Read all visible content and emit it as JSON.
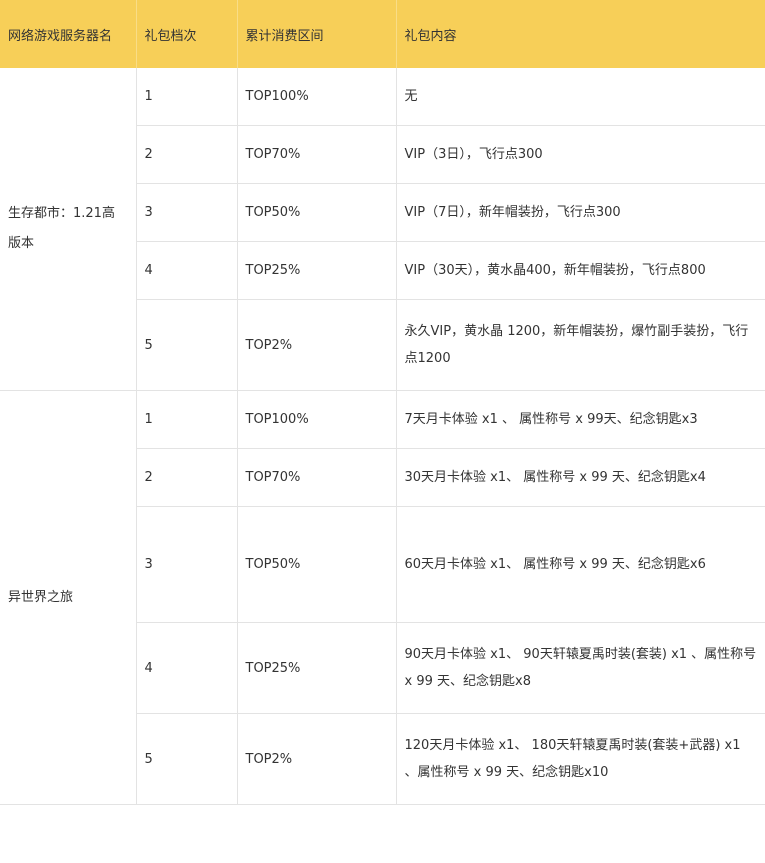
{
  "table": {
    "headers": [
      "网络游戏服务器名",
      "礼包档次",
      "累计消费区间",
      "礼包内容"
    ],
    "groups": [
      {
        "server": "生存都市：1.21高版本",
        "rows": [
          {
            "tier": "1",
            "range": "TOP100%",
            "content": "无"
          },
          {
            "tier": "2",
            "range": "TOP70%",
            "content": "VIP（3日），飞行点300"
          },
          {
            "tier": "3",
            "range": "TOP50%",
            "content": "VIP（7日），新年帽装扮，飞行点300"
          },
          {
            "tier": "4",
            "range": "TOP25%",
            "content": "VIP（30天），黄水晶400，新年帽装扮，飞行点800"
          },
          {
            "tier": "5",
            "range": "TOP2%",
            "content": "永久VIP，黄水晶 1200，新年帽装扮，爆竹副手装扮，飞行点1200"
          }
        ]
      },
      {
        "server": "异世界之旅",
        "rows": [
          {
            "tier": "1",
            "range": "TOP100%",
            "content": "7天月卡体验 x1 、 属性称号 x 99天、纪念钥匙x3"
          },
          {
            "tier": "2",
            "range": "TOP70%",
            "content": "30天月卡体验 x1、 属性称号 x 99 天、纪念钥匙x4"
          },
          {
            "tier": "3",
            "range": "TOP50%",
            "content": "60天月卡体验 x1、 属性称号 x 99 天、纪念钥匙x6"
          },
          {
            "tier": "4",
            "range": "TOP25%",
            "content": "90天月卡体验 x1、 90天轩辕夏禹时装(套装) x1 、属性称号 x 99 天、纪念钥匙x8"
          },
          {
            "tier": "5",
            "range": "TOP2%",
            "content": "120天月卡体验 x1、 180天轩辕夏禹时装(套装+武器) x1 、属性称号 x 99 天、纪念钥匙x10"
          }
        ]
      }
    ]
  }
}
